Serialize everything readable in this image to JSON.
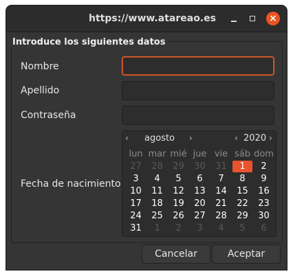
{
  "window": {
    "title": "https://www.atareao.es"
  },
  "form": {
    "frame_label": "Introduce los siguientes datos",
    "fields": [
      {
        "label": "Nombre",
        "value": ""
      },
      {
        "label": "Apellido",
        "value": ""
      },
      {
        "label": "Contraseña",
        "value": ""
      }
    ],
    "birth_label": "Fecha de nacimiento"
  },
  "calendar": {
    "month": "agosto",
    "year": "2020",
    "prev_month": "‹",
    "next_month": "›",
    "prev_year": "‹",
    "next_year": "›",
    "weekdays": [
      "lun",
      "mar",
      "mié",
      "jue",
      "vie",
      "sáb",
      "dom"
    ],
    "weeks": [
      [
        "27",
        "28",
        "29",
        "30",
        "31",
        "1",
        "2"
      ],
      [
        "3",
        "4",
        "5",
        "6",
        "7",
        "8",
        "9"
      ],
      [
        "10",
        "11",
        "12",
        "13",
        "14",
        "15",
        "16"
      ],
      [
        "17",
        "18",
        "19",
        "20",
        "21",
        "22",
        "23"
      ],
      [
        "24",
        "25",
        "26",
        "27",
        "28",
        "29",
        "30"
      ],
      [
        "31",
        "1",
        "2",
        "3",
        "4",
        "5",
        "6"
      ]
    ],
    "other_month_flags": [
      [
        true,
        true,
        true,
        true,
        true,
        false,
        false
      ],
      [
        false,
        false,
        false,
        false,
        false,
        false,
        false
      ],
      [
        false,
        false,
        false,
        false,
        false,
        false,
        false
      ],
      [
        false,
        false,
        false,
        false,
        false,
        false,
        false
      ],
      [
        false,
        false,
        false,
        false,
        false,
        false,
        false
      ],
      [
        false,
        true,
        true,
        true,
        true,
        true,
        true
      ]
    ],
    "selected_day": "1"
  },
  "buttons": {
    "cancel": "Cancelar",
    "accept": "Aceptar"
  },
  "colors": {
    "accent": "#e9542c",
    "close": "#e95420"
  }
}
